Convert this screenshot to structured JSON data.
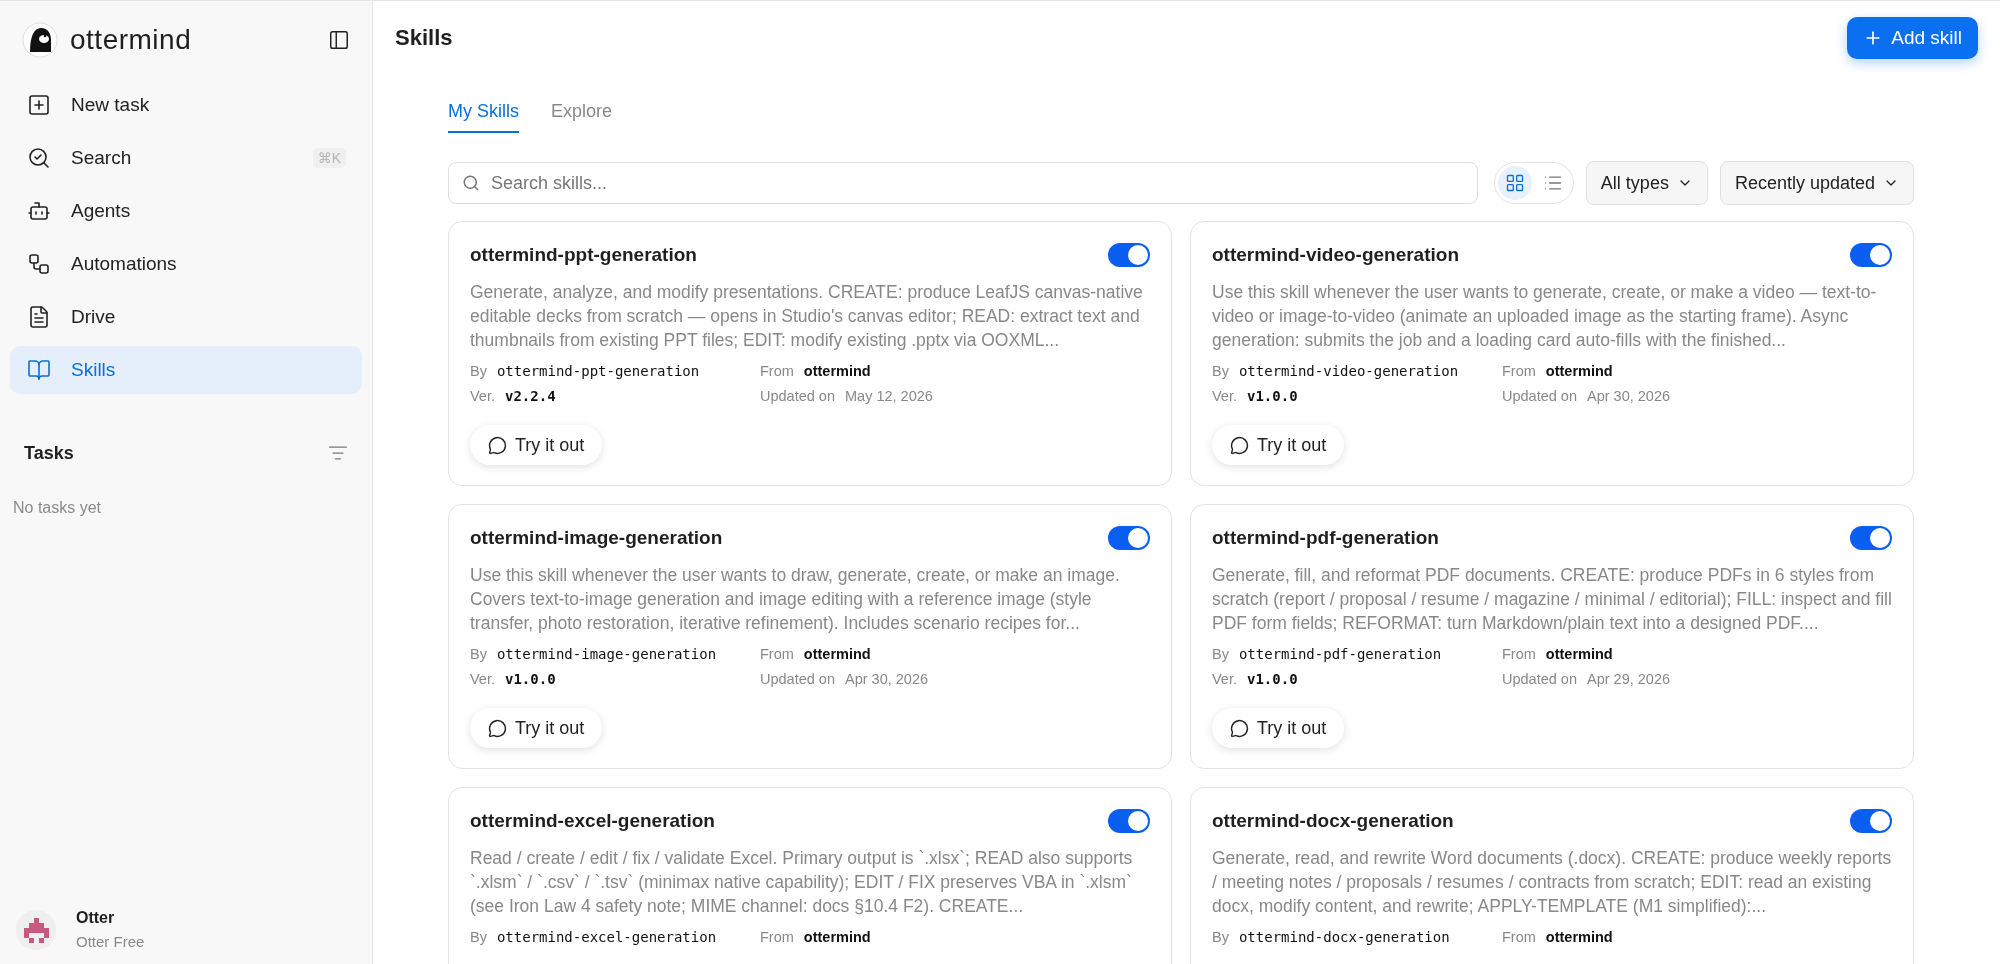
{
  "sidebar": {
    "brand": "ottermind",
    "items": [
      {
        "kind": "new",
        "label": "New task",
        "selected": false
      },
      {
        "kind": "search",
        "label": "Search",
        "shortcut": "⌘K",
        "selected": false
      },
      {
        "kind": "agents",
        "label": "Agents",
        "selected": false
      },
      {
        "kind": "automations",
        "label": "Automations",
        "selected": false
      },
      {
        "kind": "drive",
        "label": "Drive",
        "selected": false
      },
      {
        "kind": "skills",
        "label": "Skills",
        "selected": true
      }
    ],
    "tasks": {
      "title": "Tasks",
      "empty": "No tasks yet"
    },
    "user": {
      "name": "Otter",
      "plan": "Otter Free"
    }
  },
  "header": {
    "title": "Skills",
    "add_button": "Add skill"
  },
  "tabs": [
    {
      "label": "My Skills",
      "selected": true
    },
    {
      "label": "Explore",
      "selected": false
    }
  ],
  "search": {
    "placeholder": "Search skills..."
  },
  "views": [
    {
      "kind": "grid",
      "selected": true
    },
    {
      "kind": "list",
      "selected": false
    }
  ],
  "filters": [
    {
      "label": "All types"
    },
    {
      "label": "Recently updated"
    }
  ],
  "cards": [
    {
      "title": "ottermind-ppt-generation",
      "on": true,
      "description": "Generate, analyze, and modify presentations. CREATE: produce LeafJS canvas-native editable decks from scratch — opens in Studio's canvas editor; READ: extract text and thumbnails from existing PPT files; EDIT: modify existing .pptx via OOXML...",
      "by_label": "By",
      "by": "ottermind-ppt-generation",
      "from_label": "From",
      "from": "ottermind",
      "version_label": "Ver.",
      "version": "v2.2.4",
      "updated_label": "Updated on",
      "updated": "May 12, 2026",
      "action": "Try it out"
    },
    {
      "title": "ottermind-video-generation",
      "on": true,
      "description": "Use this skill whenever the user wants to generate, create, or make a video — text-to-video or image-to-video (animate an uploaded image as the starting frame). Async generation: submits the job and a loading card auto-fills with the finished...",
      "by_label": "By",
      "by": "ottermind-video-generation",
      "from_label": "From",
      "from": "ottermind",
      "version_label": "Ver.",
      "version": "v1.0.0",
      "updated_label": "Updated on",
      "updated": "Apr 30, 2026",
      "action": "Try it out"
    },
    {
      "title": "ottermind-image-generation",
      "on": true,
      "description": "Use this skill whenever the user wants to draw, generate, create, or make an image. Covers text-to-image generation and image editing with a reference image (style transfer, photo restoration, iterative refinement). Includes scenario recipes for...",
      "by_label": "By",
      "by": "ottermind-image-generation",
      "from_label": "From",
      "from": "ottermind",
      "version_label": "Ver.",
      "version": "v1.0.0",
      "updated_label": "Updated on",
      "updated": "Apr 30, 2026",
      "action": "Try it out"
    },
    {
      "title": "ottermind-pdf-generation",
      "on": true,
      "description": "Generate, fill, and reformat PDF documents. CREATE: produce PDFs in 6 styles from scratch (report / proposal / resume / magazine / minimal / editorial); FILL: inspect and fill PDF form fields; REFORMAT: turn Markdown/plain text into a designed PDF....",
      "by_label": "By",
      "by": "ottermind-pdf-generation",
      "from_label": "From",
      "from": "ottermind",
      "version_label": "Ver.",
      "version": "v1.0.0",
      "updated_label": "Updated on",
      "updated": "Apr 29, 2026",
      "action": "Try it out"
    },
    {
      "title": "ottermind-excel-generation",
      "on": true,
      "description": "Read / create / edit / fix / validate Excel. Primary output is `.xlsx`; READ also supports `.xlsm` / `.csv` / `.tsv` (minimax native capability); EDIT / FIX preserves VBA in `.xlsm` (see Iron Law 4 safety note; MIME channel: docs §10.4 F2). CREATE...",
      "by_label": "By",
      "by": "ottermind-excel-generation",
      "from_label": "From",
      "from": "ottermind"
    },
    {
      "title": "ottermind-docx-generation",
      "on": true,
      "description": "Generate, read, and rewrite Word documents (.docx). CREATE: produce weekly reports / meeting notes / proposals / resumes / contracts from scratch; EDIT: read an existing docx, modify content, and rewrite; APPLY-TEMPLATE (M1 simplified):...",
      "by_label": "By",
      "by": "ottermind-docx-generation",
      "from_label": "From",
      "from": "ottermind"
    }
  ]
}
